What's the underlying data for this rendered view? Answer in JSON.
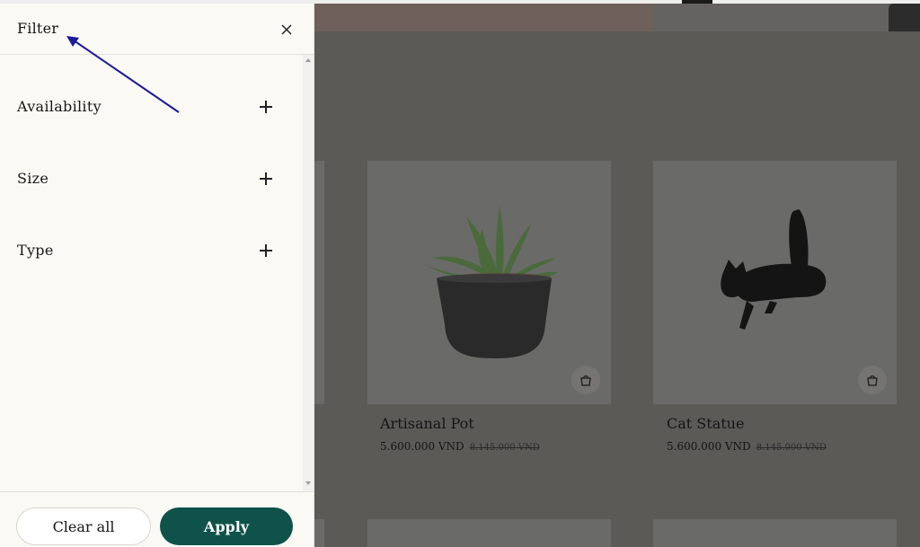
{
  "filter_drawer": {
    "title": "Filter",
    "close_icon": "close-icon",
    "sections": [
      {
        "label": "Availability",
        "icon": "plus-icon"
      },
      {
        "label": "Size",
        "icon": "plus-icon"
      },
      {
        "label": "Type",
        "icon": "plus-icon"
      }
    ],
    "footer": {
      "clear_label": "Clear all",
      "apply_label": "Apply"
    }
  },
  "products": [
    {
      "title": "Artisanal Pot",
      "price": "5.600.000 VND",
      "old_price": "8.145.000 VND",
      "icon": "shopping-bag-icon"
    },
    {
      "title": "Cat Statue",
      "price": "5.600.000 VND",
      "old_price": "8.145.000 VND",
      "icon": "shopping-bag-icon"
    }
  ],
  "colors": {
    "apply_button": "#0e5249",
    "drawer_background": "#fbf9f4",
    "overlay": "#5a5854",
    "annotation_arrow": "#1a1a9c"
  }
}
